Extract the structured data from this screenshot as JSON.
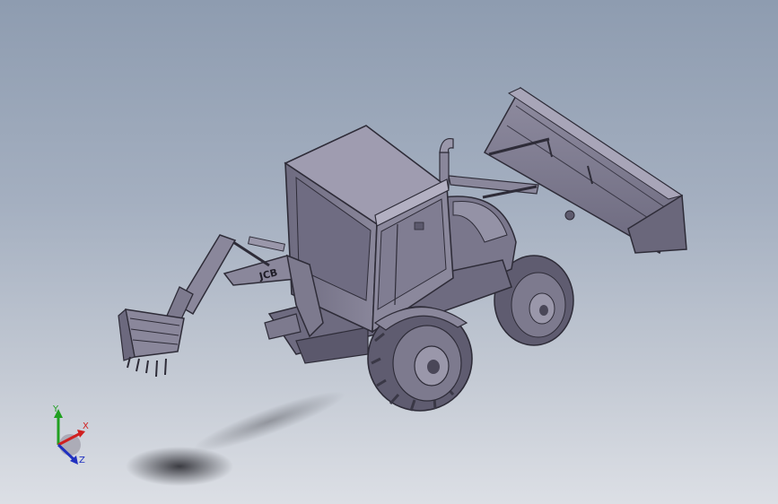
{
  "viewport": {
    "background_top": "#8e9cb0",
    "background_bottom": "#dcdfe5"
  },
  "model": {
    "body_color": "#7d7a8e",
    "dark_color": "#4a4758",
    "light_color": "#9a97aa",
    "boom_decal": "JCB"
  },
  "triad": {
    "x_label": "X",
    "y_label": "Y",
    "z_label": "Z",
    "x_color": "#d02020",
    "y_color": "#20a020",
    "z_color": "#2030c0"
  }
}
